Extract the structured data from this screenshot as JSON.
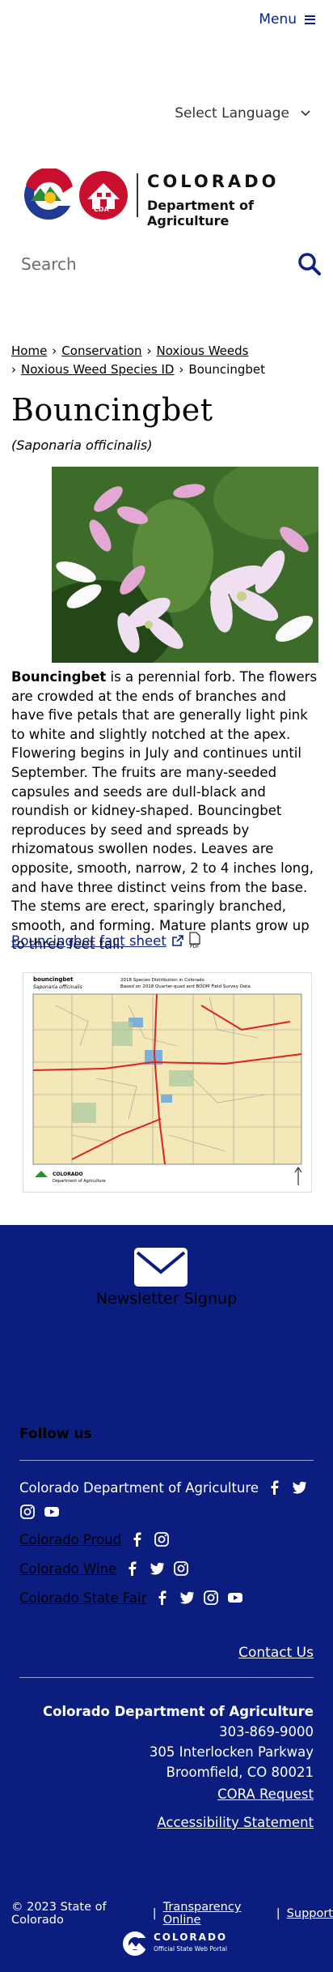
{
  "header": {
    "menu_label": "Menu",
    "language_label": "Select Language",
    "logo_line1": "COLORADO",
    "logo_line2": "Department of Agriculture",
    "logo_badge": "CDA",
    "search_placeholder": "Search"
  },
  "breadcrumb": {
    "home": "Home",
    "conservation": "Conservation",
    "noxious_weeds": "Noxious Weeds",
    "species_id": "Noxious Weed Species ID",
    "current": "Bouncingbet",
    "separator": "›"
  },
  "page": {
    "title": "Bouncingbet",
    "scientific_name": "(Saponaria officinalis)",
    "intro_bold": "Bouncingbet",
    "intro_rest": " is a perennial forb. The flowers are crowded at the ends of branches and have five petals that are generally light pink to white and slightly notched at the apex. Flowering begins in July and continues until September. The fruits are many-seeded capsules and seeds are dull-black and roundish or kidney-shaped. Bouncingbet reproduces by seed and spreads by rhizomatous swollen nodes. Leaves are opposite, smooth, narrow, 2 to 4 inches long, and have three distinct veins from the base. The stems are erect, sparingly branched, smooth, and forming. Mature plants grow up to three feet tall.",
    "fact_sheet_label": "Bouncingbet fact sheet",
    "pdf_label": "PDF"
  },
  "map": {
    "species": "bouncingbet",
    "species_sci": "Saponaria officinalis",
    "heading1": "2018 Species Distribution in Colorado",
    "heading2": "Based on 2018 Quarter-quad and BOOM Field Survey Data",
    "footer_org_line1": "COLORADO",
    "footer_org_line2": "Department of Agriculture"
  },
  "footer": {
    "newsletter": "Newsletter Signup",
    "follow_us": "Follow us",
    "cda": "Colorado Department of Agriculture",
    "proud": "Colorado Proud",
    "wine": "Colorado Wine",
    "fair": "Colorado State Fair",
    "contact": "Contact Us",
    "org": "Colorado Department of Agriculture",
    "phone": "303-869-9000",
    "street": "305 Interlocken Parkway",
    "city": "Broomfield, CO 80021",
    "cora": "CORA Request",
    "accessibility": "Accessibility Statement"
  },
  "bottom": {
    "copyright": "© 2023 State of Colorado",
    "pipe": "|",
    "transparency": "Transparency Online",
    "support": "Support",
    "portal_line1": "COLORADO",
    "portal_line2": "Official State Web Portal"
  },
  "colors": {
    "navy": "#0b1d7e",
    "link": "#0d2286"
  }
}
